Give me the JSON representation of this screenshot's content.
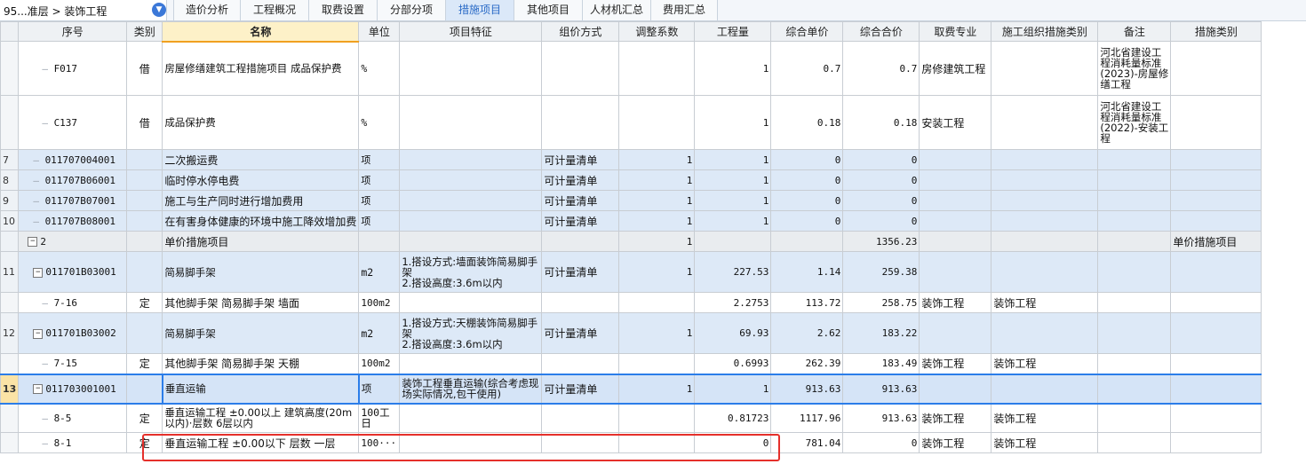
{
  "breadcrumb": "95...准层 > 装饰工程",
  "breadcrumb_icon": "chevron-double-down-icon",
  "tabs": [
    {
      "label": "造价分析",
      "w": 76
    },
    {
      "label": "工程概况",
      "w": 78
    },
    {
      "label": "取费设置",
      "w": 78
    },
    {
      "label": "分部分项",
      "w": 78
    },
    {
      "label": "措施项目",
      "w": 78,
      "active": true
    },
    {
      "label": "其他项目",
      "w": 78
    },
    {
      "label": "人材机汇总",
      "w": 78
    },
    {
      "label": "费用汇总",
      "w": 76
    }
  ],
  "columns": [
    "",
    "序号",
    "类别",
    "名称",
    "单位",
    "项目特征",
    "组价方式",
    "调整系数",
    "工程量",
    "综合单价",
    "综合合价",
    "取费专业",
    "施工组织措施类别",
    "备注",
    "措施类别"
  ],
  "rows": [
    {
      "no": "",
      "code": "F017",
      "type": "借",
      "name": "房屋修缮建筑工程措施项目 成品保护费",
      "unit": "%",
      "feature": "",
      "method": "",
      "coef": "",
      "qty": "1",
      "price": "0.7",
      "total": "0.7",
      "fee": "房修建筑工程",
      "org": "",
      "remark": "河北省建设工程消耗量标准(2023)-房屋修缮工程",
      "cat": "",
      "style": "",
      "h": 61,
      "level": 2
    },
    {
      "no": "",
      "code": "C137",
      "type": "借",
      "name": "成品保护费",
      "unit": "%",
      "feature": "",
      "method": "",
      "coef": "",
      "qty": "1",
      "price": "0.18",
      "total": "0.18",
      "fee": "安装工程",
      "org": "",
      "remark": "河北省建设工程消耗量标准(2022)-安装工程",
      "cat": "",
      "style": "",
      "h": 61,
      "level": 2
    },
    {
      "no": "7",
      "code": "011707004001",
      "type": "",
      "name": "二次搬运费",
      "unit": "项",
      "feature": "",
      "method": "可计量清单",
      "coef": "1",
      "qty": "1",
      "price": "0",
      "total": "0",
      "fee": "",
      "org": "",
      "remark": "",
      "cat": "",
      "style": "blue",
      "h": 23,
      "level": 1
    },
    {
      "no": "8",
      "code": "011707B06001",
      "type": "",
      "name": "临时停水停电费",
      "unit": "项",
      "feature": "",
      "method": "可计量清单",
      "coef": "1",
      "qty": "1",
      "price": "0",
      "total": "0",
      "fee": "",
      "org": "",
      "remark": "",
      "cat": "",
      "style": "blue",
      "h": 23,
      "level": 1
    },
    {
      "no": "9",
      "code": "011707B07001",
      "type": "",
      "name": "施工与生产同时进行增加费用",
      "unit": "项",
      "feature": "",
      "method": "可计量清单",
      "coef": "1",
      "qty": "1",
      "price": "0",
      "total": "0",
      "fee": "",
      "org": "",
      "remark": "",
      "cat": "",
      "style": "blue",
      "h": 23,
      "level": 1
    },
    {
      "no": "10",
      "code": "011707B08001",
      "type": "",
      "name": "在有害身体健康的环境中施工降效增加费",
      "unit": "项",
      "feature": "",
      "method": "可计量清单",
      "coef": "1",
      "qty": "1",
      "price": "0",
      "total": "0",
      "fee": "",
      "org": "",
      "remark": "",
      "cat": "",
      "style": "blue",
      "h": 23,
      "level": 1
    },
    {
      "no": "",
      "code": "2",
      "type": "",
      "name": "单价措施项目",
      "unit": "",
      "feature": "",
      "method": "",
      "coef": "1",
      "qty": "",
      "price": "",
      "total": "1356.23",
      "fee": "",
      "org": "",
      "remark": "",
      "cat": "单价措施项目",
      "style": "gray",
      "h": 23,
      "level": 0,
      "expander": true
    },
    {
      "no": "11",
      "code": "011701B03001",
      "type": "",
      "name": "简易脚手架",
      "unit": "m2",
      "feature": "1.搭设方式:墙面装饰简易脚手架\n2.搭设高度:3.6m以内",
      "method": "可计量清单",
      "coef": "1",
      "qty": "227.53",
      "price": "1.14",
      "total": "259.38",
      "fee": "",
      "org": "",
      "remark": "",
      "cat": "",
      "style": "blue",
      "h": 46,
      "level": 1,
      "expander": true
    },
    {
      "no": "",
      "code": "7-16",
      "type": "定",
      "name": "其他脚手架 简易脚手架 墙面",
      "unit": "100m2",
      "feature": "",
      "method": "",
      "coef": "",
      "qty": "2.2753",
      "price": "113.72",
      "total": "258.75",
      "fee": "装饰工程",
      "org": "装饰工程",
      "remark": "",
      "cat": "",
      "style": "",
      "h": 23,
      "level": 2
    },
    {
      "no": "12",
      "code": "011701B03002",
      "type": "",
      "name": "简易脚手架",
      "unit": "m2",
      "feature": "1.搭设方式:天棚装饰简易脚手架\n2.搭设高度:3.6m以内",
      "method": "可计量清单",
      "coef": "1",
      "qty": "69.93",
      "price": "2.62",
      "total": "183.22",
      "fee": "",
      "org": "",
      "remark": "",
      "cat": "",
      "style": "blue",
      "h": 46,
      "level": 1,
      "expander": true
    },
    {
      "no": "",
      "code": "7-15",
      "type": "定",
      "name": "其他脚手架 简易脚手架 天棚",
      "unit": "100m2",
      "feature": "",
      "method": "",
      "coef": "",
      "qty": "0.6993",
      "price": "262.39",
      "total": "183.49",
      "fee": "装饰工程",
      "org": "装饰工程",
      "remark": "",
      "cat": "",
      "style": "",
      "h": 23,
      "level": 2
    },
    {
      "no": "13",
      "code": "011703001001",
      "type": "",
      "name": "垂直运输",
      "unit": "项",
      "feature": "装饰工程垂直运输(综合考虑现场实际情况,包干使用)",
      "method": "可计量清单",
      "coef": "1",
      "qty": "1",
      "price": "913.63",
      "total": "913.63",
      "fee": "",
      "org": "",
      "remark": "",
      "cat": "",
      "style": "sel",
      "h": 33,
      "level": 1,
      "expander": true
    },
    {
      "no": "",
      "code": "8-5",
      "type": "定",
      "name": "垂直运输工程 ±0.00以上 建筑高度(20m以内)·层数 6层以内",
      "unit": "100工日",
      "feature": "",
      "method": "",
      "coef": "",
      "qty": "0.81723",
      "price": "1117.96",
      "total": "913.63",
      "fee": "装饰工程",
      "org": "装饰工程",
      "remark": "",
      "cat": "",
      "style": "",
      "h": 33,
      "level": 2
    },
    {
      "no": "",
      "code": "8-1",
      "type": "定",
      "name": "垂直运输工程 ±0.00以下 层数 一层",
      "unit": "100···",
      "feature": "",
      "method": "",
      "coef": "",
      "qty": "0",
      "price": "781.04",
      "total": "0",
      "fee": "装饰工程",
      "org": "装饰工程",
      "remark": "",
      "cat": "",
      "style": "",
      "h": 23,
      "level": 2
    }
  ],
  "colors": {
    "selection": "#2b7de9",
    "annotation": "#e5302b",
    "active_tab": "#2b6bc7"
  }
}
